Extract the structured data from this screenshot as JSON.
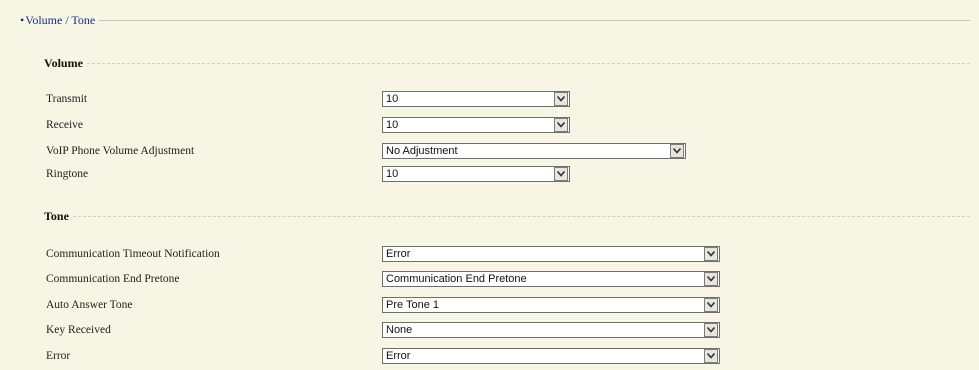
{
  "section": {
    "bullet": "•",
    "title": "Volume / Tone"
  },
  "volume": {
    "heading": "Volume",
    "rows": [
      {
        "label": "Transmit",
        "value": "10"
      },
      {
        "label": "Receive",
        "value": "10"
      },
      {
        "label": "VoIP Phone Volume Adjustment",
        "value": "No Adjustment"
      },
      {
        "label": "Ringtone",
        "value": "10"
      }
    ]
  },
  "tone": {
    "heading": "Tone",
    "rows": [
      {
        "label": "Communication Timeout Notification",
        "value": "Error"
      },
      {
        "label": "Communication End Pretone",
        "value": "Communication End Pretone"
      },
      {
        "label": "Auto Answer Tone",
        "value": "Pre Tone 1"
      },
      {
        "label": "Key Received",
        "value": "None"
      },
      {
        "label": "Error",
        "value": "Error"
      }
    ]
  },
  "icons": {
    "dropdown": "chevron-down-icon"
  },
  "colors": {
    "background": "#f7f5e4",
    "section_title": "#1b2f8a"
  }
}
